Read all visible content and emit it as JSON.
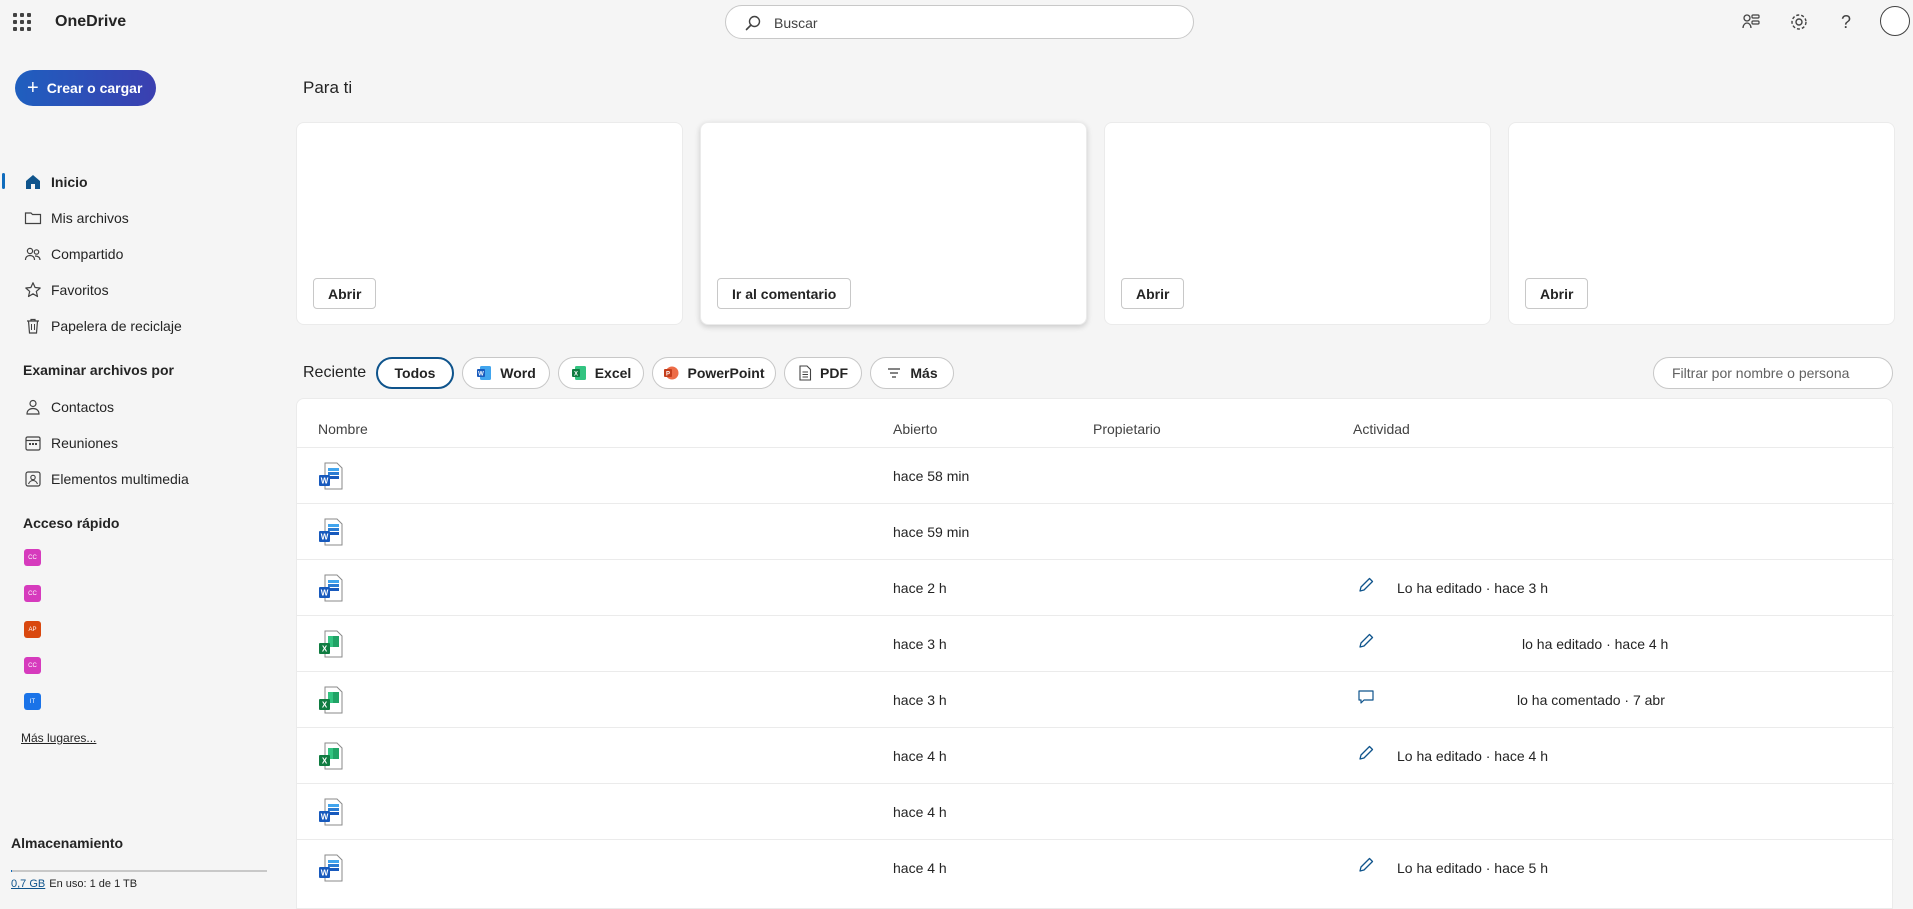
{
  "header": {
    "app_title": "OneDrive",
    "search_placeholder": "Buscar",
    "icons": [
      "waffle-icon",
      "search-icon",
      "share-icon",
      "gear-icon",
      "help-icon",
      "avatar"
    ]
  },
  "sidebar": {
    "create_label": "Crear o cargar",
    "nav": [
      {
        "label": "Inicio",
        "icon": "home-icon",
        "active": true
      },
      {
        "label": "Mis archivos",
        "icon": "folder-icon"
      },
      {
        "label": "Compartido",
        "icon": "people-icon"
      },
      {
        "label": "Favoritos",
        "icon": "star-icon"
      },
      {
        "label": "Papelera de reciclaje",
        "icon": "trash-icon"
      }
    ],
    "browse_title": "Examinar archivos por",
    "browse": [
      {
        "label": "Contactos",
        "icon": "person-icon"
      },
      {
        "label": "Reuniones",
        "icon": "calendar-icon"
      },
      {
        "label": "Elementos multimedia",
        "icon": "image-icon"
      }
    ],
    "quick_access_title": "Acceso rápido",
    "quick_access": [
      {
        "text": "CC",
        "color": "#d63bbd"
      },
      {
        "text": "CC",
        "color": "#d63bbd"
      },
      {
        "text": "AP",
        "color": "#d9480f"
      },
      {
        "text": "CC",
        "color": "#d63bbd"
      },
      {
        "text": "IT",
        "color": "#1a73e8"
      }
    ],
    "more_places": "Más lugares...",
    "storage_title": "Almacenamiento",
    "storage_used": "0,7 GB",
    "storage_text": "En uso: 1 de 1 TB",
    "storage_fraction": 0.0007
  },
  "main": {
    "for_you_title": "Para ti",
    "cards": [
      {
        "button": "Abrir"
      },
      {
        "button": "Ir al comentario"
      },
      {
        "button": "Abrir"
      },
      {
        "button": "Abrir"
      }
    ],
    "recent_label": "Reciente",
    "filters": [
      {
        "label": "Todos",
        "active": true
      },
      {
        "label": "Word",
        "icon": "word-icon"
      },
      {
        "label": "Excel",
        "icon": "excel-icon"
      },
      {
        "label": "PowerPoint",
        "icon": "powerpoint-icon"
      },
      {
        "label": "PDF",
        "icon": "pdf-icon"
      },
      {
        "label": "Más",
        "icon": "filter-lines-icon"
      }
    ],
    "filter_placeholder": "Filtrar por nombre o persona",
    "columns": {
      "name": "Nombre",
      "opened": "Abierto",
      "owner": "Propietario",
      "activity": "Actividad"
    },
    "rows": [
      {
        "type": "word",
        "opened": "hace 58 min",
        "activity": "",
        "activity_icon": ""
      },
      {
        "type": "word",
        "opened": "hace 59 min",
        "activity": "",
        "activity_icon": ""
      },
      {
        "type": "word",
        "opened": "hace 2 h",
        "activity": "Lo ha editado · hace 3 h",
        "activity_icon": "pencil-icon"
      },
      {
        "type": "excel",
        "opened": "hace 3 h",
        "activity": "lo ha editado · hace 4 h",
        "activity_icon": "pencil-icon"
      },
      {
        "type": "excel",
        "opened": "hace 3 h",
        "activity": "lo ha comentado · 7 abr",
        "activity_icon": "comment-icon"
      },
      {
        "type": "excel",
        "opened": "hace 4 h",
        "activity": "Lo ha editado · hace 4 h",
        "activity_icon": "pencil-icon"
      },
      {
        "type": "word",
        "opened": "hace 4 h",
        "activity": "",
        "activity_icon": ""
      },
      {
        "type": "word",
        "opened": "hace 4 h",
        "activity": "Lo ha editado · hace 5 h",
        "activity_icon": "pencil-icon"
      }
    ]
  }
}
